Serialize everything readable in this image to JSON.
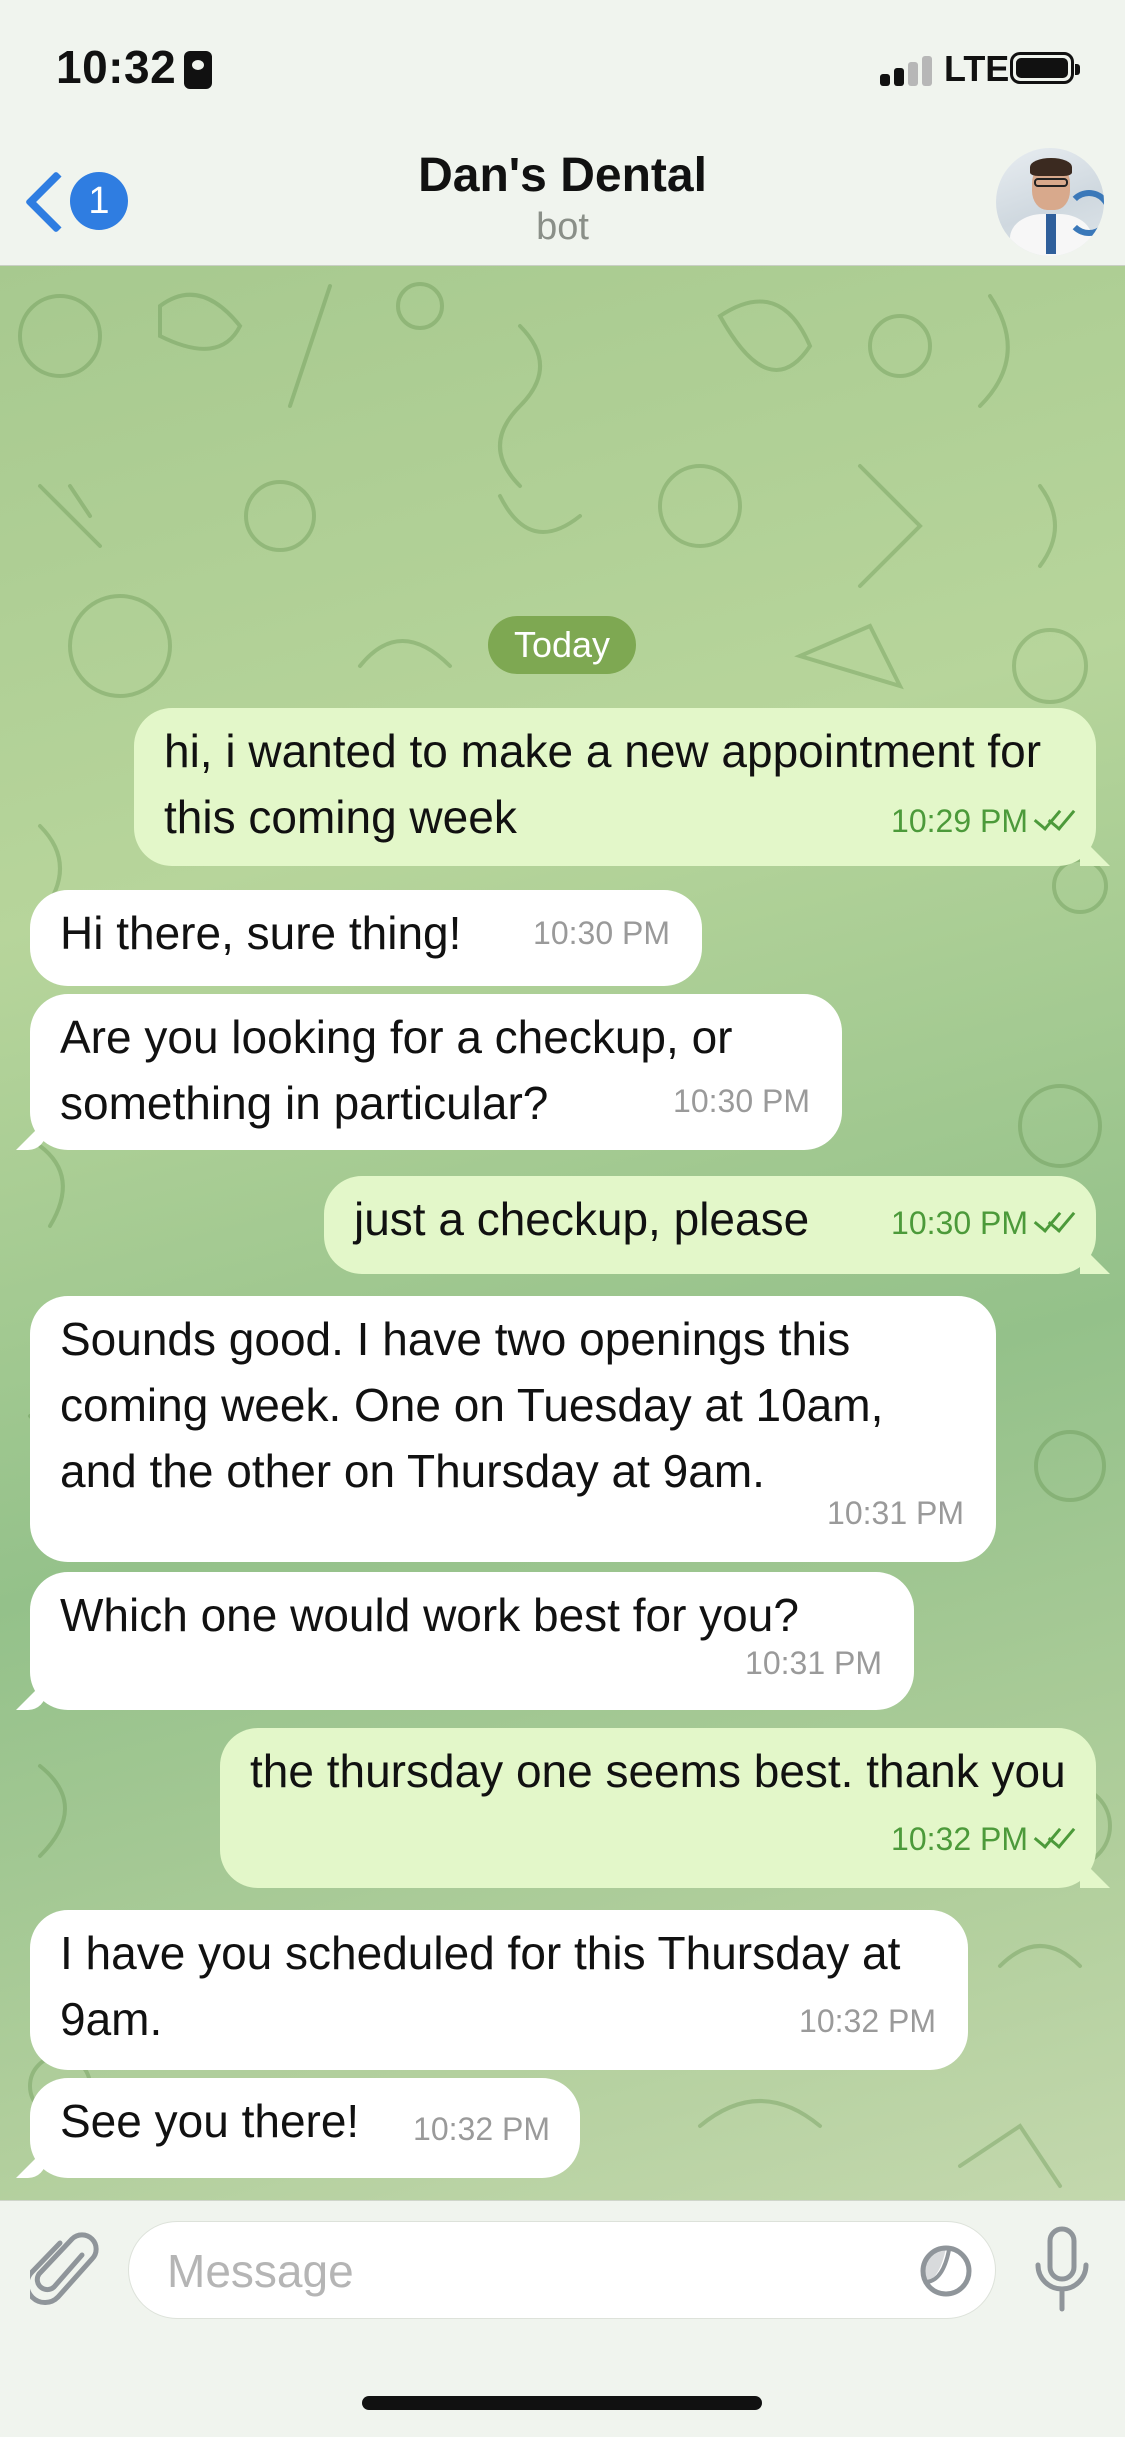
{
  "status_bar": {
    "time": "10:32",
    "network": "LTE"
  },
  "header": {
    "back_count": "1",
    "title": "Dan's Dental",
    "subtitle": "bot"
  },
  "chat": {
    "date_label": "Today",
    "messages": [
      {
        "direction": "out",
        "text": "hi, i wanted to make a new appointment for this coming week",
        "time": "10:29 PM",
        "read": true
      },
      {
        "direction": "in",
        "text": "Hi there, sure thing!",
        "time": "10:30 PM"
      },
      {
        "direction": "in",
        "text": "Are you looking for a checkup, or something in particular?",
        "time": "10:30 PM"
      },
      {
        "direction": "out",
        "text": "just a checkup, please",
        "time": "10:30 PM",
        "read": true
      },
      {
        "direction": "in",
        "text": "Sounds good. I have two openings this coming week. One on Tuesday at 10am, and the other on Thursday at 9am.",
        "time": "10:31 PM"
      },
      {
        "direction": "in",
        "text": "Which one would work best for you?",
        "time": "10:31 PM"
      },
      {
        "direction": "out",
        "text": "the thursday one seems best. thank you",
        "time": "10:32 PM",
        "read": true
      },
      {
        "direction": "in",
        "text": "I have you scheduled for this Thursday at 9am.",
        "time": "10:32 PM"
      },
      {
        "direction": "in",
        "text": "See you there!",
        "time": "10:32 PM"
      }
    ]
  },
  "input": {
    "placeholder": "Message"
  },
  "colors": {
    "accent": "#2f7de1",
    "outgoing_bubble": "#e3f7c9",
    "incoming_bubble": "#ffffff",
    "read_check": "#4c9a3a",
    "date_pill": "#7ea852"
  },
  "icons": [
    "back-chevron-icon",
    "attachment-icon",
    "sticker-icon",
    "microphone-icon",
    "double-check-icon",
    "battery-icon",
    "signal-icon"
  ]
}
